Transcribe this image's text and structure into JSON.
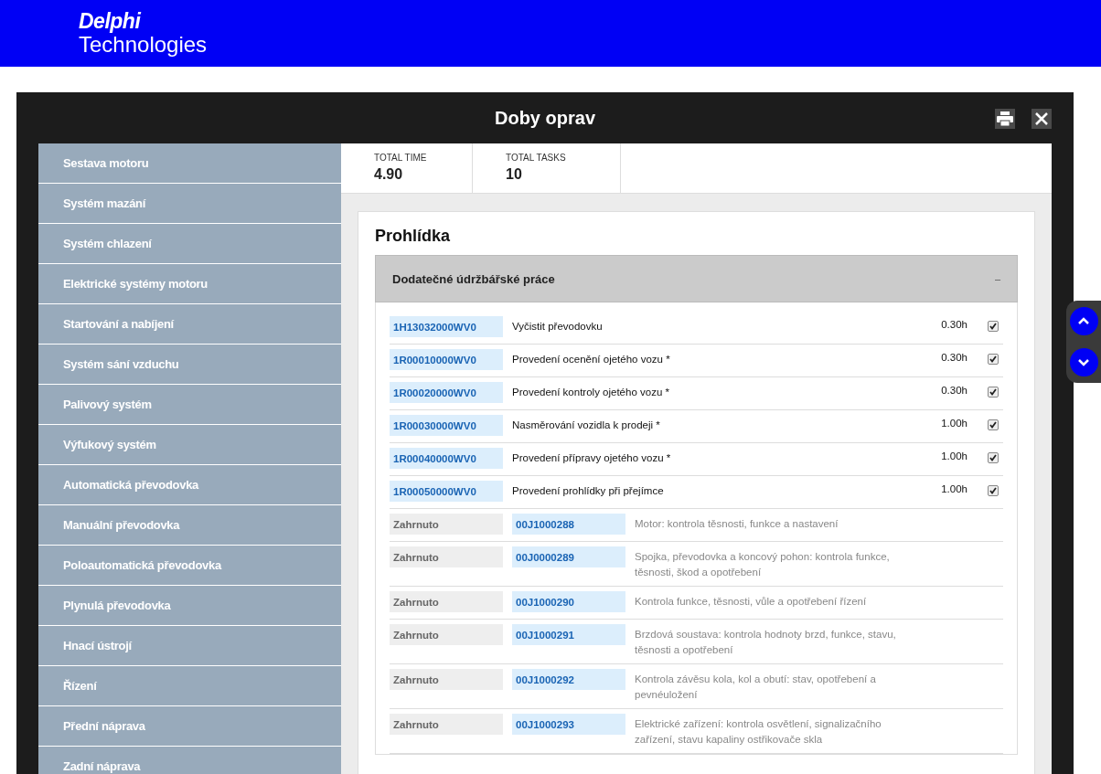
{
  "header": {
    "logo_line_1": "Delphi",
    "logo_line_2": "Technologies"
  },
  "dialog": {
    "title": "Doby oprav"
  },
  "sidebar": {
    "items": [
      {
        "label": "Sestava motoru"
      },
      {
        "label": "Systém mazání"
      },
      {
        "label": "Systém chlazení"
      },
      {
        "label": "Elektrické systémy motoru"
      },
      {
        "label": "Startování a nabíjení"
      },
      {
        "label": "Systém sání vzduchu"
      },
      {
        "label": "Palivový systém"
      },
      {
        "label": "Výfukový systém"
      },
      {
        "label": "Automatická převodovka"
      },
      {
        "label": "Manuální převodovka"
      },
      {
        "label": "Poloautomatická převodovka"
      },
      {
        "label": "Plynulá převodovka"
      },
      {
        "label": "Hnací ústrojí"
      },
      {
        "label": "Řízení"
      },
      {
        "label": "Přední náprava"
      },
      {
        "label": "Zadní náprava"
      }
    ]
  },
  "summary": [
    {
      "label": "TOTAL TIME",
      "value": "4.90"
    },
    {
      "label": "TOTAL TASKS",
      "value": "10"
    }
  ],
  "section": {
    "title": "Prohlídka",
    "group": {
      "title": "Dodatečné údržbářské práce",
      "toggle": "–",
      "rows": [
        {
          "kind": "task",
          "code": "1H13032000WV0",
          "description": "Vyčistit převodovku",
          "time": "0.30h",
          "checked": true
        },
        {
          "kind": "task",
          "code": "1R00010000WV0",
          "description": "Provedení ocenění ojetého vozu *",
          "time": "0.30h",
          "checked": true
        },
        {
          "kind": "task",
          "code": "1R00020000WV0",
          "description": "Provedení kontroly ojetého vozu *",
          "time": "0.30h",
          "checked": true
        },
        {
          "kind": "task",
          "code": "1R00030000WV0",
          "description": "Nasměrování vozidla k prodeji *",
          "time": "1.00h",
          "checked": true
        },
        {
          "kind": "task",
          "code": "1R00040000WV0",
          "description": "Provedení přípravy ojetého vozu *",
          "time": "1.00h",
          "checked": true
        },
        {
          "kind": "task",
          "code": "1R00050000WV0",
          "description": "Provedení prohlídky při přejímce",
          "time": "1.00h",
          "checked": true
        },
        {
          "kind": "included",
          "status": "Zahrnuto",
          "code": "00J1000288",
          "description": "Motor: kontrola těsnosti, funkce a nastavení"
        },
        {
          "kind": "included",
          "status": "Zahrnuto",
          "code": "00J0000289",
          "description": "Spojka, převodovka a koncový pohon: kontrola funkce, těsnosti, škod a opotřebení"
        },
        {
          "kind": "included",
          "status": "Zahrnuto",
          "code": "00J1000290",
          "description": "Kontrola funkce, těsnosti, vůle a opotřebení řízení"
        },
        {
          "kind": "included",
          "status": "Zahrnuto",
          "code": "00J1000291",
          "description": "Brzdová soustava: kontrola hodnoty brzd, funkce, stavu, těsnosti a opotřebení"
        },
        {
          "kind": "included",
          "status": "Zahrnuto",
          "code": "00J1000292",
          "description": "Kontrola závěsu kola, kol a obutí: stav, opotřebení a pevnéuložení"
        },
        {
          "kind": "included",
          "status": "Zahrnuto",
          "code": "00J1000293",
          "description": "Elektrické zařízení: kontrola osvětlení, signalizačního zařízení, stavu kapaliny ostřikovače skla"
        }
      ]
    }
  }
}
